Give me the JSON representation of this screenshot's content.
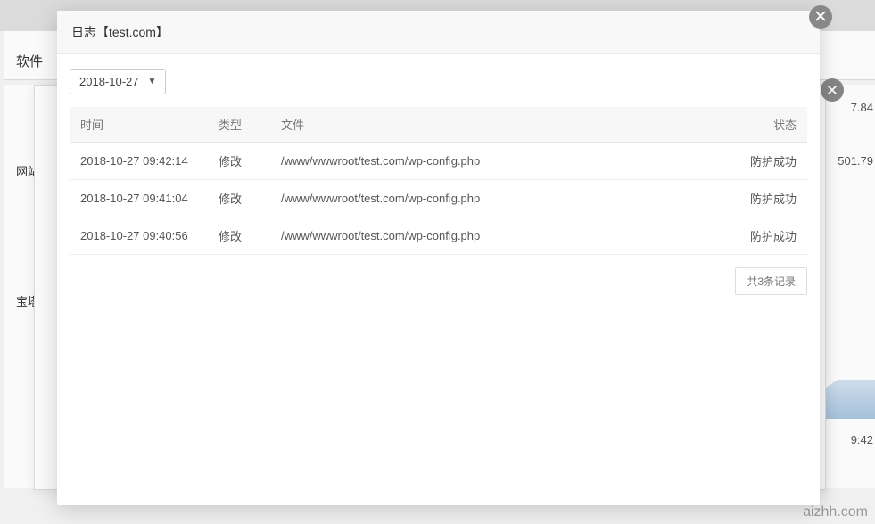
{
  "background": {
    "topLabel": "软件",
    "sideLabel1": "网站",
    "sideLabel2": "宝塔",
    "num1": "7.84",
    "num2": "501.79",
    "timeLabel": "9:42",
    "watermark": "aizhh.com"
  },
  "modal": {
    "title": "日志【test.com】",
    "dateSelector": "2018-10-27",
    "table": {
      "headers": {
        "time": "时间",
        "type": "类型",
        "file": "文件",
        "status": "状态"
      },
      "rows": [
        {
          "time": "2018-10-27 09:42:14",
          "type": "修改",
          "file": "/www/wwwroot/test.com/wp-config.php",
          "status": "防护成功"
        },
        {
          "time": "2018-10-27 09:41:04",
          "type": "修改",
          "file": "/www/wwwroot/test.com/wp-config.php",
          "status": "防护成功"
        },
        {
          "time": "2018-10-27 09:40:56",
          "type": "修改",
          "file": "/www/wwwroot/test.com/wp-config.php",
          "status": "防护成功"
        }
      ]
    },
    "pagination": "共3条记录"
  }
}
